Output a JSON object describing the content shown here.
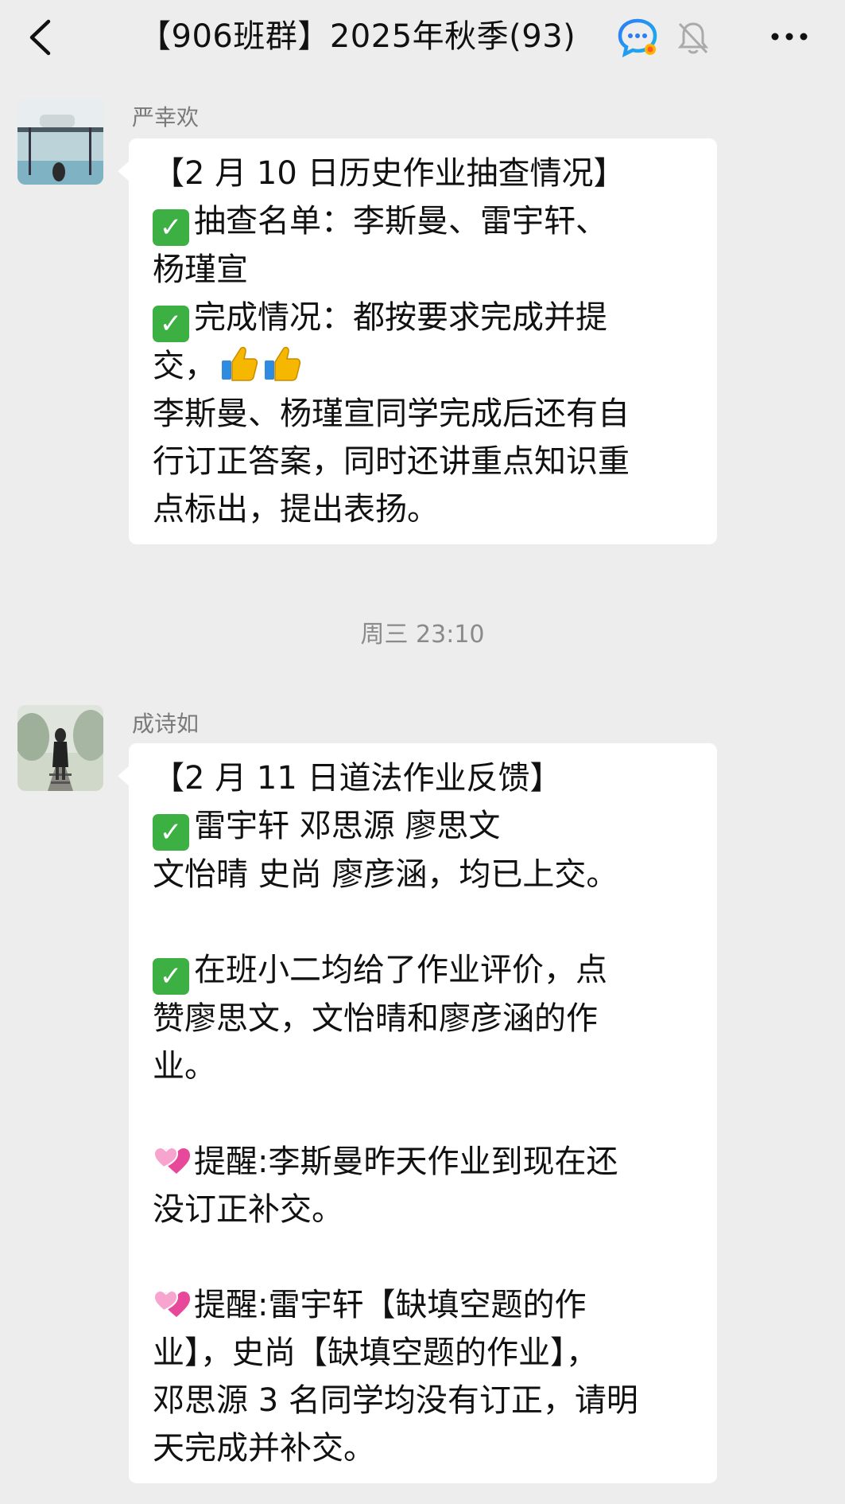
{
  "header": {
    "title": "【906班群】2025年秋季(93)",
    "back_icon": "chevron-left-icon",
    "ai_icon": "chat-assistant-icon",
    "mute_icon": "bell-off-icon",
    "more_icon": "more-icon"
  },
  "messages": [
    {
      "sender": "严幸欢",
      "lines": [
        {
          "text": "【2 月 10 日历史作业抽查情况】"
        },
        {
          "icon": "check",
          "text": "抽查名单：李斯曼、雷宇轩、"
        },
        {
          "text": "杨瑾宣"
        },
        {
          "icon": "check",
          "text": "完成情况：都按要求完成并提"
        },
        {
          "text": "交，",
          "suffix": "thumbs"
        },
        {
          "text": "李斯曼、杨瑾宣同学完成后还有自"
        },
        {
          "text": "行订正答案，同时还讲重点知识重"
        },
        {
          "text": "点标出，提出表扬。"
        }
      ]
    },
    {
      "sender": "成诗如",
      "lines": [
        {
          "text": "【2 月 11 日道法作业反馈】"
        },
        {
          "icon": "check",
          "text": "雷宇轩 邓思源 廖思文"
        },
        {
          "text": "文怡晴 史尚 廖彦涵，均已上交。"
        },
        {
          "text": ""
        },
        {
          "icon": "check",
          "text": "在班小二均给了作业评价，点"
        },
        {
          "text": "赞廖思文，文怡晴和廖彦涵的作"
        },
        {
          "text": "业。"
        },
        {
          "text": ""
        },
        {
          "icon": "heart",
          "text": "提醒:李斯曼昨天作业到现在还"
        },
        {
          "text": "没订正补交。"
        },
        {
          "text": ""
        },
        {
          "icon": "heart",
          "text": "提醒:雷宇轩【缺填空题的作"
        },
        {
          "text": "业】，史尚【缺填空题的作业】，"
        },
        {
          "text": "邓思源 3 名同学均没有订正，请明"
        },
        {
          "text": "天完成并补交。"
        }
      ]
    }
  ],
  "timestamp": "周三 23:10",
  "colors": {
    "background": "#ededed",
    "bubble": "#ffffff",
    "check": "#3cb043",
    "heart": "#e8489a",
    "meta_text": "#7a7a7a"
  }
}
